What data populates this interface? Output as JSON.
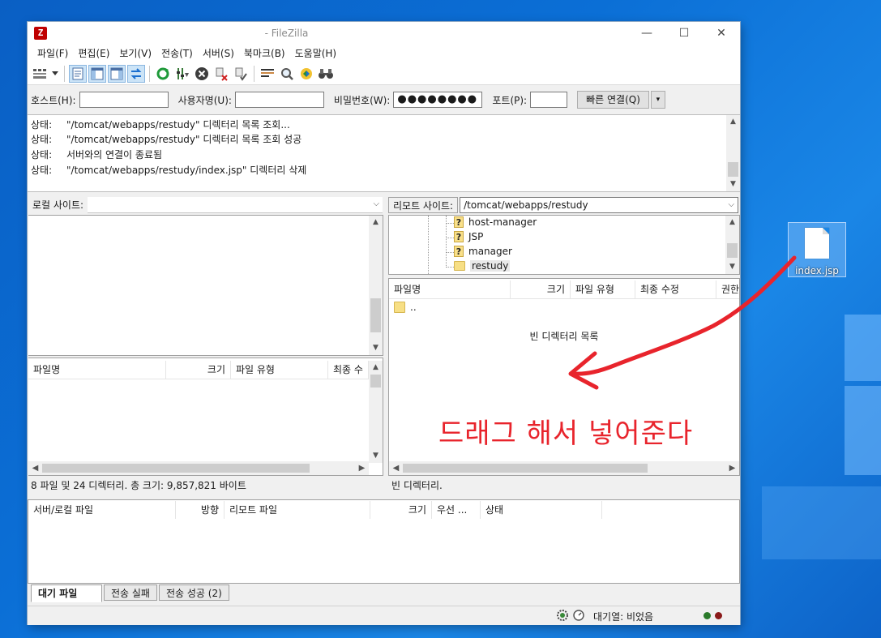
{
  "window": {
    "title": "- FileZilla",
    "app_icon_letter": "Z",
    "min_glyph": "—",
    "max_glyph": "☐",
    "close_glyph": "✕"
  },
  "menu": [
    "파일(F)",
    "편집(E)",
    "보기(V)",
    "전송(T)",
    "서버(S)",
    "북마크(B)",
    "도움말(H)"
  ],
  "toolbar": {
    "icons": [
      "site-manager-icon",
      "dropdown-icon",
      "message-log-icon",
      "local-tree-icon",
      "remote-tree-icon",
      "transfer-queue-icon",
      "refresh-icon",
      "filter-icon",
      "cancel-icon",
      "disconnect-icon",
      "reconnect-icon",
      "directory-listing-icon",
      "search-icon",
      "compare-icon",
      "find-icon"
    ]
  },
  "quickconnect": {
    "host_label": "호스트(H):",
    "host_value": "",
    "user_label": "사용자명(U):",
    "user_value": "",
    "pass_label": "비밀번호(W):",
    "pass_value": "●●●●●●●●",
    "port_label": "포트(P):",
    "port_value": "",
    "connect_label": "빠른 연결(Q)",
    "dropdown_glyph": "▾"
  },
  "log": [
    {
      "label": "상태:",
      "text": "\"/tomcat/webapps/restudy\" 디렉터리 목록 조회..."
    },
    {
      "label": "상태:",
      "text": "\"/tomcat/webapps/restudy\" 디렉터리 목록 조회 성공"
    },
    {
      "label": "상태:",
      "text": "서버와의 연결이 종료됨"
    },
    {
      "label": "상태:",
      "text": "\"/tomcat/webapps/restudy/index.jsp\" 디렉터리 삭제"
    }
  ],
  "local": {
    "site_label": "로컬 사이트:",
    "site_path": "",
    "columns": [
      "파일명",
      "크기",
      "파일 유형",
      "최종 수"
    ],
    "status": "8 파일 및 24 디렉터리. 총 크기: 9,857,821 바이트"
  },
  "remote": {
    "site_label": "리모트 사이트:",
    "site_path": "/tomcat/webapps/restudy",
    "tree": [
      {
        "name": "host-manager",
        "icon": "question-folder-icon"
      },
      {
        "name": "JSP",
        "icon": "question-folder-icon"
      },
      {
        "name": "manager",
        "icon": "question-folder-icon"
      },
      {
        "name": "restudy",
        "icon": "folder-icon"
      }
    ],
    "columns": [
      "파일명",
      "크기",
      "파일 유형",
      "최종 수정",
      "권한"
    ],
    "parent_entry": "..",
    "empty_message": "빈 디렉터리 목록",
    "status": "빈 디렉터리."
  },
  "queue": {
    "columns": [
      "서버/로컬 파일",
      "방향",
      "리모트 파일",
      "크기",
      "우선 ...",
      "상태"
    ],
    "tabs": [
      "대기 파일",
      "전송 실패",
      "전송 성공 (2)"
    ]
  },
  "statusbar": {
    "queue_text": "대기열: 비었음"
  },
  "desktop": {
    "file_name": "index.jsp"
  },
  "annotation": {
    "text": "드래그 해서 넣어준다",
    "color": "#e8242c"
  }
}
